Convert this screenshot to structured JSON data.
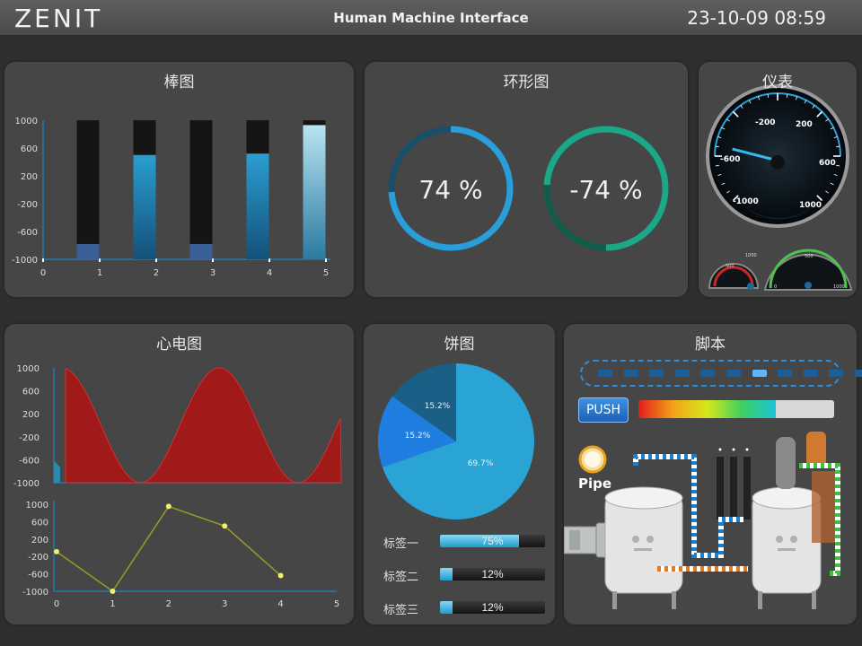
{
  "header": {
    "brand": "ZENIT",
    "title": "Human Machine Interface",
    "datetime": "23-10-09 08:59"
  },
  "bar_panel": {
    "title": "棒图",
    "chart_data": {
      "type": "bar",
      "x_ticks": [
        "0",
        "1",
        "2",
        "3",
        "4",
        "5"
      ],
      "y_ticks": [
        "1000",
        "600",
        "200",
        "-200",
        "-600",
        "-1000"
      ],
      "ylim": [
        -1000,
        1000
      ],
      "categories": [
        1,
        2,
        3,
        4,
        5
      ],
      "values": [
        -780,
        500,
        -780,
        520,
        930
      ],
      "colors": {
        "track": "#151515",
        "fill_dark": "#3a5f98",
        "fill": "#1f86b0",
        "fill_light": "#a8d9ea"
      }
    }
  },
  "ring_panel": {
    "title": "环形图",
    "rings": [
      {
        "label": "74 %",
        "value": 0.74,
        "color": "#2a9ed8"
      },
      {
        "label": "-74 %",
        "value": 0.74,
        "color": "#1aa888"
      }
    ]
  },
  "gauge_panel": {
    "title": "仪表",
    "main_gauge": {
      "ticks": [
        "-1000",
        "-600",
        "-200",
        "200",
        "600",
        "1000"
      ],
      "value": -560
    },
    "small_gauge_left": {
      "ticks": [
        "500",
        "1000"
      ]
    },
    "small_gauge_right": {
      "ticks": [
        "500",
        "0",
        "1000"
      ]
    }
  },
  "ecg_panel": {
    "title": "心电图",
    "chart_data": [
      {
        "type": "area",
        "y_ticks": [
          "1000",
          "600",
          "200",
          "-200",
          "-600",
          "-1000"
        ],
        "ylim": [
          -1000,
          1000
        ],
        "color": "#a01a1a"
      },
      {
        "type": "line",
        "x_ticks": [
          "0",
          "1",
          "2",
          "3",
          "4",
          "5"
        ],
        "y_ticks": [
          "1000",
          "600",
          "200",
          "-200",
          "-600",
          "-1000"
        ],
        "xlim": [
          0,
          5
        ],
        "ylim": [
          -1000,
          1000
        ],
        "x": [
          0,
          1,
          2,
          3,
          4
        ],
        "y": [
          -90,
          -1000,
          950,
          500,
          -640
        ],
        "color": "#9a9a2a"
      }
    ]
  },
  "pie_panel": {
    "title": "饼图",
    "chart_data": {
      "type": "pie",
      "slices": [
        {
          "label": "69.7%",
          "value": 69.7,
          "color": "#2aa4d4"
        },
        {
          "label": "15.2%",
          "value": 15.2,
          "color": "#1f7ee0"
        },
        {
          "label": "15.2%",
          "value": 15.2,
          "color": "#1a5f86"
        }
      ]
    },
    "rows": [
      {
        "label": "标签一",
        "value_text": "75%",
        "value": 0.75
      },
      {
        "label": "标签二",
        "value_text": "12%",
        "value": 0.12
      },
      {
        "label": "标签三",
        "value_text": "12%",
        "value": 0.12
      }
    ]
  },
  "script_panel": {
    "title": "脚本",
    "push_label": "PUSH",
    "progress": 0.7,
    "led_count": 11,
    "led_active_index": 6,
    "pipe_label": "Pipe"
  }
}
